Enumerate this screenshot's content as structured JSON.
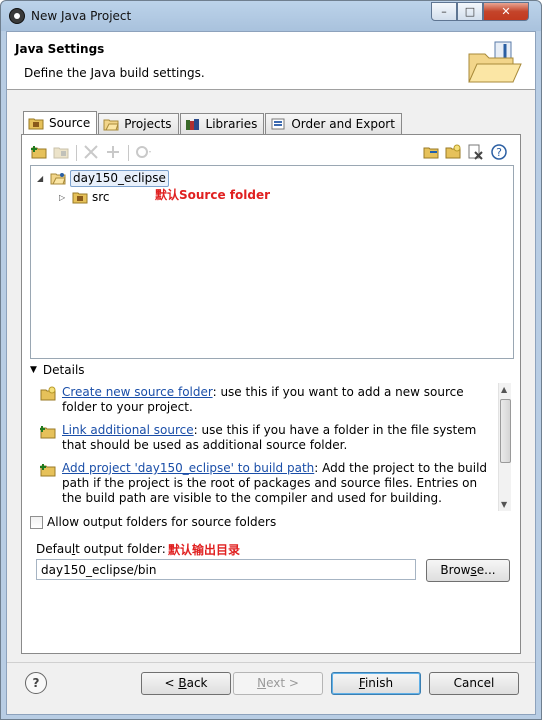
{
  "window": {
    "title": "New Java Project",
    "min_glyph": "–",
    "max_glyph": "□",
    "close_glyph": "✕"
  },
  "header": {
    "title": "Java Settings",
    "description": "Define the Java build settings."
  },
  "tabs": [
    {
      "label": "Source",
      "icon": "source-folder-icon"
    },
    {
      "label": "Projects",
      "icon": "projects-icon"
    },
    {
      "label": "Libraries",
      "icon": "libraries-icon"
    },
    {
      "label": "Order and Export",
      "icon": "order-export-icon"
    }
  ],
  "tree": {
    "root": "day150_eclipse",
    "child": "src"
  },
  "annotations": {
    "source_folder": "默认Source folder",
    "output_dir": "默认输出目录"
  },
  "details": {
    "heading": "Details",
    "items": [
      {
        "link": "Create new source folder",
        "text": ": use this if you want to add a new source folder to your project."
      },
      {
        "link": "Link additional source",
        "text": ": use this if you have a folder in the file system that should be used as additional source folder."
      },
      {
        "link": "Add project 'day150_eclipse' to build path",
        "text": ": Add the project to the build path if the project is the root of packages and source files. Entries on the build path are visible to the compiler and used for building."
      }
    ]
  },
  "allow_output": {
    "label": "Allow output folders for source folders",
    "checked": false
  },
  "output": {
    "label_pre": "Defau",
    "label_mnemonic": "l",
    "label_post": "t output folder:",
    "value": "day150_eclipse/bin"
  },
  "buttons": {
    "browse_pre": "Brow",
    "browse_mnemonic": "s",
    "browse_post": "e...",
    "back_pre": "< ",
    "back_mnemonic": "B",
    "back_post": "ack",
    "next_mnemonic": "N",
    "next_post": "ext >",
    "finish_mnemonic": "F",
    "finish_post": "inish",
    "cancel": "Cancel",
    "help": "?"
  },
  "colors": {
    "annotation": "#e02020",
    "link": "#1a4ea8"
  }
}
